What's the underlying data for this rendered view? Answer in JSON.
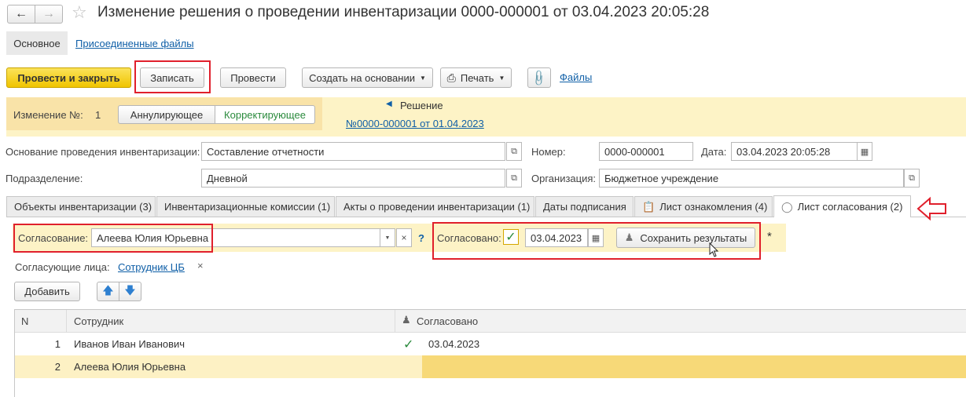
{
  "window": {
    "title": "Изменение решения о проведении инвентаризации 0000-000001 от 03.04.2023 20:05:28"
  },
  "nav": {
    "tab_main": "Основное",
    "tab_files": "Присоединенные файлы"
  },
  "toolbar": {
    "post_close": "Провести и закрыть",
    "save": "Записать",
    "post": "Провести",
    "create_based": "Создать на основании",
    "print": "Печать",
    "files": "Файлы"
  },
  "change_panel": {
    "change_no_label": "Изменение №:",
    "change_no": "1",
    "annul": "Аннулирующее",
    "correct": "Корректирующее",
    "decision_label": "Решение",
    "decision_link": "№0000-000001 от 01.04.2023"
  },
  "form": {
    "basis_label": "Основание проведения инвентаризации:",
    "basis_value": "Составление отчетности",
    "number_label": "Номер:",
    "number_value": "0000-000001",
    "date_label": "Дата:",
    "date_value": "03.04.2023 20:05:28",
    "division_label": "Подразделение:",
    "division_value": "Дневной",
    "org_label": "Организация:",
    "org_value": "Бюджетное учреждение"
  },
  "tabs": [
    {
      "label": "Объекты инвентаризации (3)"
    },
    {
      "label": "Инвентаризационные комиссии (1)"
    },
    {
      "label": "Акты о проведении инвентаризации (1)"
    },
    {
      "label": "Даты подписания"
    },
    {
      "label": "Лист ознакомления (4)"
    },
    {
      "label": "Лист согласования (2)"
    }
  ],
  "approval": {
    "label": "Согласование:",
    "value": "Алеева Юлия Юрьевна",
    "help": "?",
    "approved_label": "Согласовано:",
    "approved_date": "03.04.2023",
    "save_results": "Сохранить результаты",
    "modified_marker": "*",
    "persons_label": "Согласующие лица:",
    "persons_link": "Сотрудник ЦБ",
    "add_button": "Добавить"
  },
  "table": {
    "headers": {
      "n": "N",
      "employee": "Сотрудник",
      "approved": "Согласовано"
    },
    "rows": [
      {
        "n": "1",
        "employee": "Иванов Иван Иванович",
        "approved": "03.04.2023",
        "check": true
      },
      {
        "n": "2",
        "employee": "Алеева Юлия Юрьевна",
        "approved": "",
        "check": false
      }
    ]
  },
  "colors": {
    "accent_yellow": "#f0c400",
    "panel_yellow": "#fdf3c6",
    "highlight_red": "#e0202c",
    "link_blue": "#0f5fa7",
    "check_green": "#2a8a3c"
  }
}
